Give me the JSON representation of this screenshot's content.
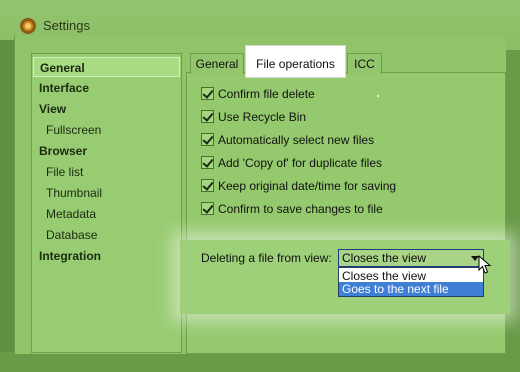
{
  "window": {
    "title": "Settings"
  },
  "sidebar": {
    "items": [
      {
        "label": "General",
        "level": 0,
        "selected": true
      },
      {
        "label": "Interface",
        "level": 0
      },
      {
        "label": "View",
        "level": 0
      },
      {
        "label": "Fullscreen",
        "level": 1
      },
      {
        "label": "Browser",
        "level": 0
      },
      {
        "label": "File list",
        "level": 1
      },
      {
        "label": "Thumbnail",
        "level": 1
      },
      {
        "label": "Metadata",
        "level": 1
      },
      {
        "label": "Database",
        "level": 1
      },
      {
        "label": "Integration",
        "level": 0
      }
    ]
  },
  "tabs": [
    {
      "label": "General"
    },
    {
      "label": "File operations",
      "active": true
    },
    {
      "label": "ICC"
    }
  ],
  "checkboxes": [
    {
      "label": "Confirm file delete",
      "checked": true
    },
    {
      "label": "Use Recycle Bin",
      "checked": true
    },
    {
      "label": "Automatically select new files",
      "checked": true
    },
    {
      "label": "Add 'Copy of' for duplicate files",
      "checked": true
    },
    {
      "label": "Keep original date/time for saving",
      "checked": true
    },
    {
      "label": "Confirm to save changes to file",
      "checked": true
    }
  ],
  "delete_option": {
    "label": "Deleting a file from view:",
    "selected": "Closes the view",
    "options": [
      "Closes the view",
      "Goes to the next file"
    ],
    "highlighted_option": "Goes to the next file"
  },
  "colors": {
    "window_green": "#8fc468",
    "highlight_blue": "#3f7fd6",
    "active_tab": "#ffffff"
  }
}
